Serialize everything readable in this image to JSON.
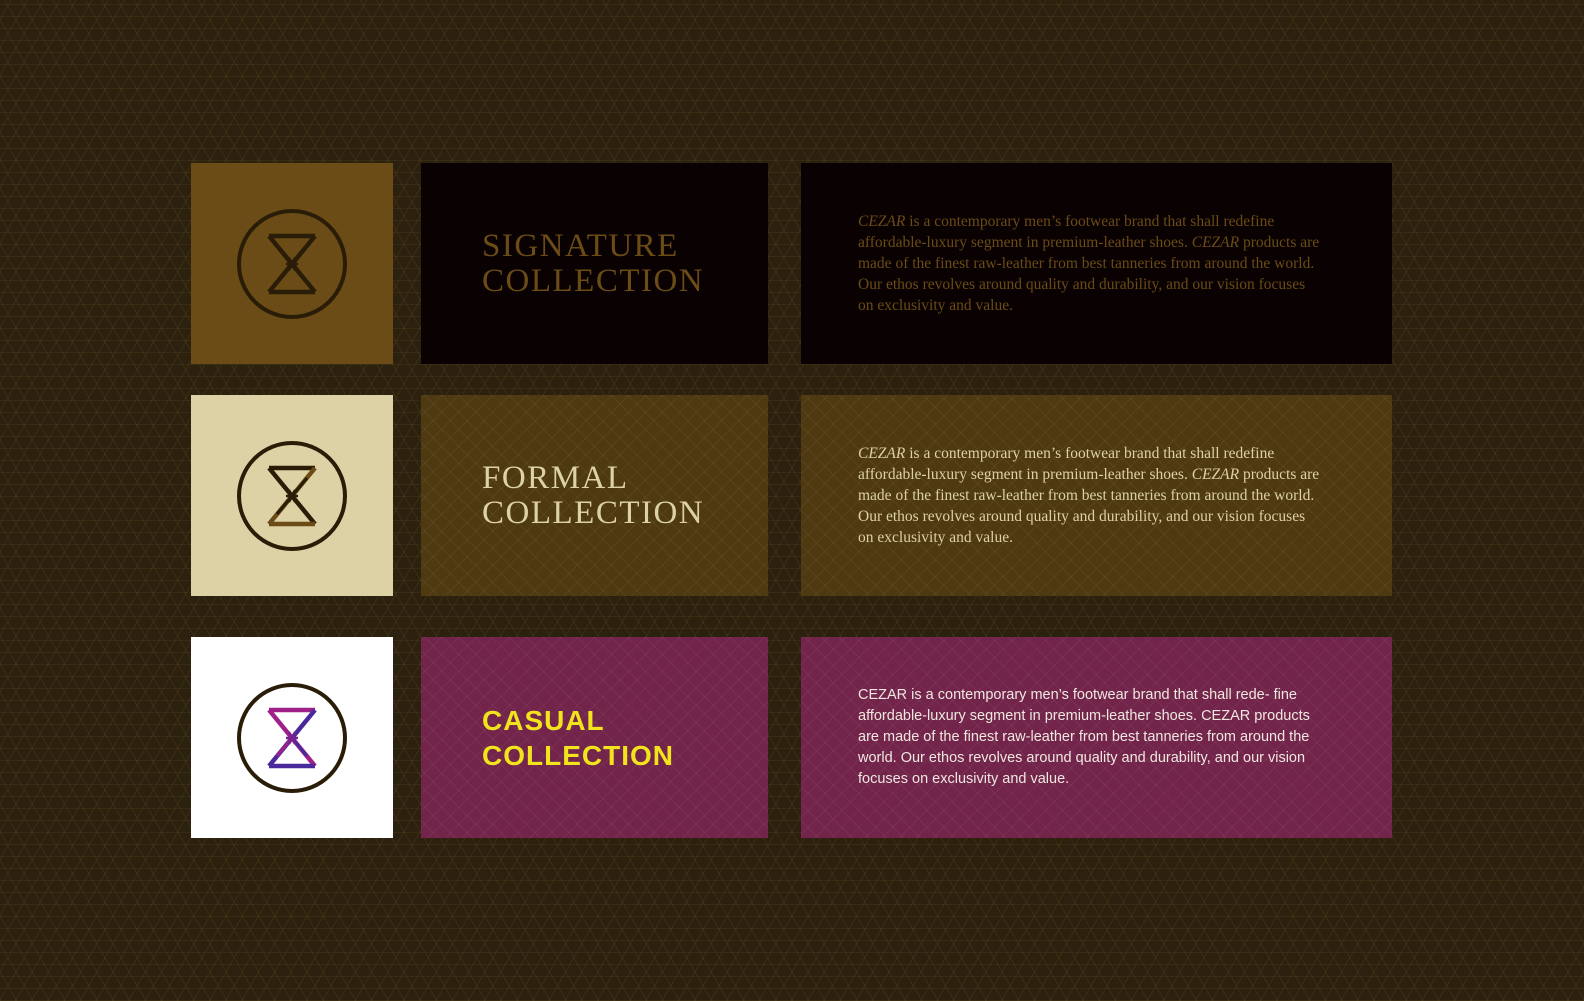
{
  "rows": [
    {
      "title_line1": "SIGNATURE",
      "title_line2": "COLLECTION",
      "desc_brand1": "CEZAR",
      "desc_mid": " is a contemporary men’s footwear brand that shall redefine affordable-luxury segment in premium-leather shoes. ",
      "desc_brand2": "CEZAR",
      "desc_tail": " products are made of the finest raw-leather from best tanneries from around the world. Our ethos revolves around quality and durability, and our vision focuses on exclusivity and value.",
      "colors": {
        "logo_bg": "#6b4b16",
        "title_bg": "#0a0202",
        "desc_bg": "#0a0202",
        "title": "#6b4b16",
        "desc": "#6b4b16",
        "logo_ring": "#2a1d08",
        "logo_mark": "#2a1d08"
      }
    },
    {
      "title_line1": "FORMAL",
      "title_line2": "COLLECTION",
      "desc_brand1": "CEZAR",
      "desc_mid": " is a contemporary men’s footwear brand that shall redefine affordable-luxury segment in premium-leather shoes. ",
      "desc_brand2": "CEZAR",
      "desc_tail": " products are made of the finest raw-leather from best tanneries from around the world. Our ethos revolves around quality and durability, and our vision focuses on exclusivity and value.",
      "colors": {
        "logo_bg": "#ddd2a5",
        "title_bg": "#4e3910",
        "desc_bg": "#4e3910",
        "title": "#ddd2a5",
        "desc": "#ddd2a5",
        "logo_ring": "#2a1d08",
        "logo_mark": "#6b4b16"
      }
    },
    {
      "title_line1": "CASUAL",
      "title_line2": "COLLECTION",
      "desc_text": "CEZAR is a contemporary men’s footwear brand that shall rede- fine affordable-luxury segment in premium-leather shoes. CEZAR products are made of the finest raw-leather from best tanneries from around the world. Our ethos revolves around quality and durability, and our vision focuses on exclusivity and value.",
      "colors": {
        "logo_bg": "#ffffff",
        "title_bg": "#72244a",
        "desc_bg": "#72244a",
        "title": "#f2e41c",
        "desc": "#f0e8e0",
        "logo_ring": "#2a1d08",
        "logo_mark": "#a0208a"
      }
    }
  ],
  "icons": {
    "brand_logo": "cezar-monogram-icon"
  }
}
